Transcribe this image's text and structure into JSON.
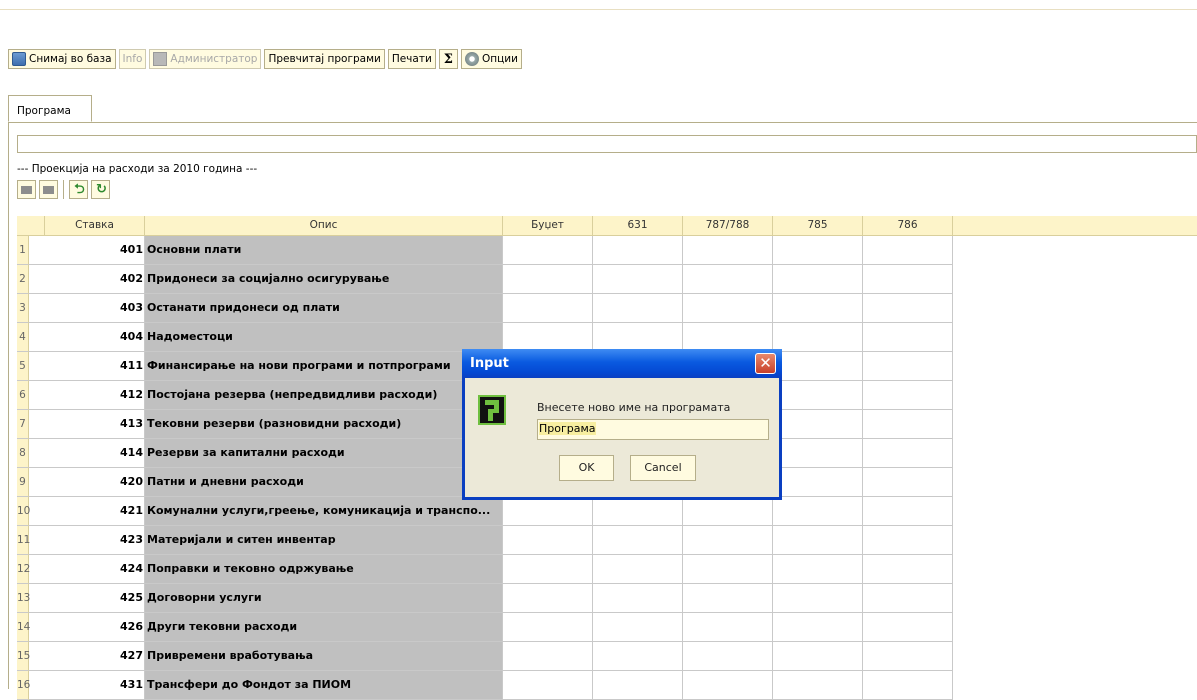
{
  "toolbar": {
    "save": "Снимај во база",
    "info": "Info",
    "admin": "Администратор",
    "load": "Превчитај програми",
    "print": "Печати",
    "sigma": "Σ",
    "options": "Опции"
  },
  "tabs": [
    {
      "label": "Програма"
    }
  ],
  "caption": "--- Проекција на расходи за 2010 година ---",
  "grid": {
    "headers": [
      "Ставка",
      "Опис",
      "Буџет",
      "631",
      "787/788",
      "785",
      "786"
    ],
    "rows": [
      {
        "n": "1",
        "code": "401",
        "desc": "Основни плати"
      },
      {
        "n": "2",
        "code": "402",
        "desc": "Придонеси за социјално осигурување"
      },
      {
        "n": "3",
        "code": "403",
        "desc": "Останати придонеси од плати"
      },
      {
        "n": "4",
        "code": "404",
        "desc": "Надоместоци"
      },
      {
        "n": "5",
        "code": "411",
        "desc": "Финансирање на нови програми и потпрограми"
      },
      {
        "n": "6",
        "code": "412",
        "desc": "Постојана резерва (непредвидливи расходи)"
      },
      {
        "n": "7",
        "code": "413",
        "desc": "Тековни резерви (разновидни расходи)"
      },
      {
        "n": "8",
        "code": "414",
        "desc": "Резерви за капитални расходи"
      },
      {
        "n": "9",
        "code": "420",
        "desc": "Патни и дневни расходи"
      },
      {
        "n": "10",
        "code": "421",
        "desc": "Комунални услуги,греење, комуникација и транспо..."
      },
      {
        "n": "11",
        "code": "423",
        "desc": "Материјали и ситен инвентар"
      },
      {
        "n": "12",
        "code": "424",
        "desc": "Поправки и тековно одржување"
      },
      {
        "n": "13",
        "code": "425",
        "desc": "Договорни услуги"
      },
      {
        "n": "14",
        "code": "426",
        "desc": "Други тековни расходи"
      },
      {
        "n": "15",
        "code": "427",
        "desc": "Привремени вработувања"
      },
      {
        "n": "16",
        "code": "431",
        "desc": "Трансфери до Фондот за ПИОМ"
      }
    ]
  },
  "dialog": {
    "title": "Input",
    "message": "Внесете ново име на програмата",
    "value": "Програма",
    "ok": "OK",
    "cancel": "Cancel"
  }
}
